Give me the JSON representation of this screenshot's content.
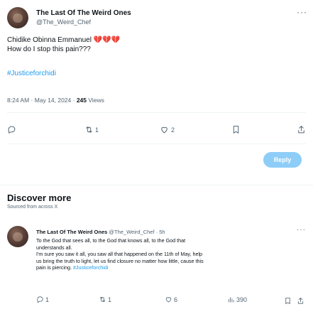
{
  "main_tweet": {
    "author_name": "The Last Of The Weird Ones",
    "author_handle": "@The_Weird_Chef",
    "more_label": "···",
    "text_line1": "Chidike Obinna Emmanuel",
    "text_line1_emoji": "💔💔💔",
    "text_line2": "How do I stop this pain???",
    "hashtag": "#Justiceforchidi",
    "time": "8:24 AM · May 14, 2024 · ",
    "views_count": "245",
    "views_label": " Views",
    "actions": {
      "reply_count": "",
      "retweet_count": "1",
      "like_count": "2"
    },
    "reply_button": "Reply"
  },
  "discover": {
    "title": "Discover more",
    "subtitle": "Sourced from across X"
  },
  "related_tweet": {
    "author_name": "The Last Of The Weird Ones",
    "author_handle": "@The_Weird_Chef",
    "time": "· 5h",
    "more_label": "···",
    "body_line1": "To the God that sees all, to the God that knows all, to the God that",
    "body_line2": "understands all.",
    "body_line3": "I'm sure you saw it all, you saw all that happened on the 11th of May, help",
    "body_line4": "us bring the truth to light, let us find closure no matter how little, cause this",
    "body_line5_prefix": "pain is piercing. ",
    "body_hashtag": "#Justiceforchidi",
    "actions": {
      "reply_count": "1",
      "retweet_count": "1",
      "like_count": "6",
      "views_count": "390"
    }
  },
  "icons": [
    "avatar",
    "more-icon",
    "reply-icon",
    "retweet-icon",
    "like-icon",
    "bookmark-icon",
    "share-icon",
    "views-icon"
  ],
  "colors": {
    "accent": "#1d9bf0",
    "reply_button": "#8ecdf8",
    "muted": "#536471"
  }
}
